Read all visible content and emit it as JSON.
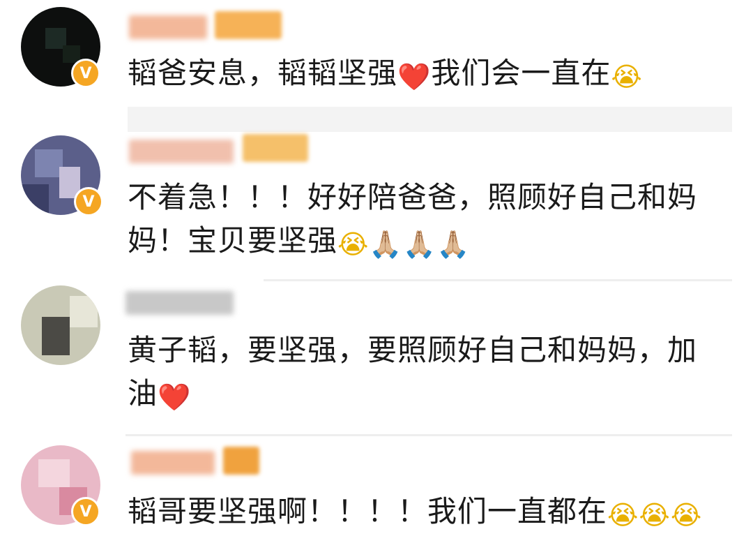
{
  "comments": [
    {
      "text": "韬爸安息，韬韬坚强",
      "emoji_after": "❤️",
      "text2": "我们会一直在",
      "emoji_end": "😭",
      "verified_badge": "V"
    },
    {
      "line1": "不着急！！！好好陪爸爸，照顾好自己和妈",
      "line2": "妈！宝贝要坚强",
      "emoji_end": "😭🙏🏼🙏🏼🙏🏼",
      "verified_badge": "V"
    },
    {
      "line1": "黄子韬，要坚强，要照顾好自己和妈妈，加",
      "line2": "油",
      "emoji_end": "❤️"
    },
    {
      "text": "韬哥要坚强啊！！！！我们一直都在",
      "emoji_end": "😭😭😭",
      "verified_badge": "V"
    }
  ],
  "colors": {
    "verified": "#f5a623",
    "heart": "#e02525",
    "text": "#1a1a1a"
  }
}
